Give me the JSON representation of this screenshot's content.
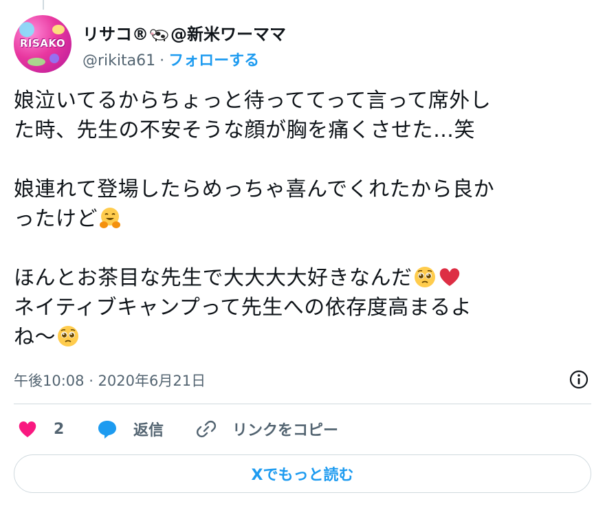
{
  "author": {
    "display_name_prefix": "リサコ®",
    "display_name_suffix": "@新米ワーママ",
    "handle": "@rikita61",
    "avatar_text": "RISAKO",
    "follow_label": "フォローする"
  },
  "tweet": {
    "line1": "娘泣いてるからちょっと待っててって言って席外し",
    "line2": "た時、先生の不安そうな顔が胸を痛くさせた…笑",
    "line3": "娘連れて登場したらめっちゃ喜んでくれたから良か",
    "line4": "ったけど",
    "line5": "ほんとお茶目な先生で大大大大好きなんだ",
    "line6": "ネイティブキャンプって先生への依存度高まるよ",
    "line7": "ね〜"
  },
  "meta": {
    "timestamp": "午後10:08 · 2020年6月21日",
    "separator": "·"
  },
  "actions": {
    "like_count": "2",
    "reply_label": "返信",
    "copy_link_label": "リンクをコピー"
  },
  "read_more_label": "Xでもっと読む",
  "colors": {
    "accent": "#1d9bf0",
    "like": "#f91880",
    "text": "#0f1419",
    "muted": "#536471",
    "border": "#cfd9de"
  },
  "icons": [
    "cow-icon",
    "hugging-face-emoji",
    "pleading-face-emoji",
    "red-heart-emoji",
    "info-icon",
    "heart-icon",
    "reply-bubble-icon",
    "link-icon"
  ]
}
